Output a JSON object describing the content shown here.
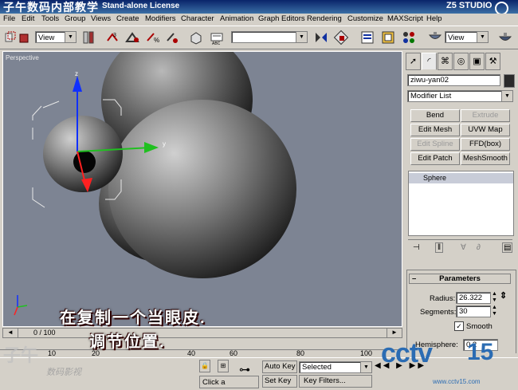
{
  "title_bar": {
    "brand": "子午数码内部教学",
    "title": "Stand-alone License",
    "studio": "Z5 STUDIO"
  },
  "menu": [
    "File",
    "Edit",
    "Tools",
    "Group",
    "Views",
    "Create",
    "Modifiers",
    "Character",
    "Animation",
    "Graph Editors",
    "Rendering",
    "Customize",
    "MAXScript",
    "Help"
  ],
  "toolbar": {
    "view_dropdown": "View",
    "selection_set": "",
    "view_dropdown_right": "View",
    "icons": [
      "select-region-icon",
      "select-object-icon",
      "select-move-icon",
      "link-icon",
      "unlink-icon",
      "bind-icon",
      "select-rotate-icon",
      "select-scale-icon",
      "snap-icon",
      "angle-snap-icon",
      "percent-snap-icon",
      "spinner-snap-icon",
      "named-sets-icon",
      "mirror-icon",
      "align-icon",
      "layer-icon",
      "curve-editor-icon",
      "schematic-icon",
      "material-editor-icon",
      "render-scene-icon",
      "quick-render-icon"
    ]
  },
  "viewport": {
    "label": "Perspective"
  },
  "command_panel": {
    "tabs": [
      "create-tab-icon",
      "modify-tab-icon",
      "hierarchy-tab-icon",
      "motion-tab-icon",
      "display-tab-icon",
      "utilities-tab-icon"
    ],
    "object_name": "ziwu-yan02",
    "object_color": "#2a2a2a",
    "modifier_list": "Modifier List",
    "modifier_buttons": [
      {
        "label": "Bend",
        "enabled": true
      },
      {
        "label": "Extrude",
        "enabled": false
      },
      {
        "label": "Edit Mesh",
        "enabled": true
      },
      {
        "label": "UVW Map",
        "enabled": true
      },
      {
        "label": "Edit Spline",
        "enabled": false
      },
      {
        "label": "FFD(box)",
        "enabled": true
      },
      {
        "label": "Edit Patch",
        "enabled": true
      },
      {
        "label": "MeshSmooth",
        "enabled": true
      }
    ],
    "stack_item": "Sphere",
    "parameters": {
      "header": "Parameters",
      "radius_label": "Radius:",
      "radius_value": "26.322",
      "segments_label": "Segments:",
      "segments_value": "30",
      "smooth_label": "Smooth",
      "smooth_checked": true,
      "hemisphere_label": "Hemisphere:",
      "hemisphere_value": "0.2"
    }
  },
  "time": {
    "frame_display": "0 / 100",
    "ticks": [
      "10",
      "20",
      "40",
      "60",
      "80",
      "100"
    ]
  },
  "status": {
    "click_text": "Click a",
    "auto_key": "Auto Key",
    "set_key": "Set Key",
    "selected": "Selected",
    "key_filters": "Key Filters..."
  },
  "subtitle": {
    "line1": "在复制一个当眼皮.",
    "line2": "调节位置."
  },
  "watermark": {
    "logo": "子午",
    "sub": "数码影视",
    "cctv": "cctv",
    "number": "15",
    "url": "www.cctv15.com"
  }
}
